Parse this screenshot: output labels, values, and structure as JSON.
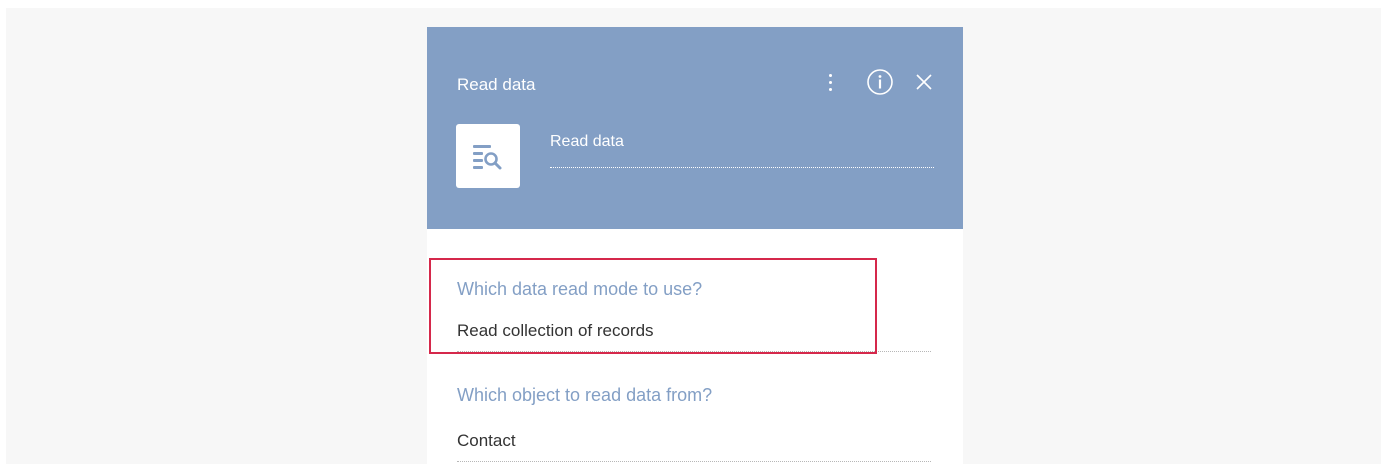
{
  "panel": {
    "title": "Read data",
    "icons": {
      "more": "more-vertical-icon",
      "info": "info-icon",
      "close": "close-icon",
      "element": "read-data-icon"
    },
    "name_value": "Read data"
  },
  "fields": [
    {
      "label": "Which data read mode to use?",
      "value": "Read collection of records"
    },
    {
      "label": "Which object to read data from?",
      "value": "Contact"
    }
  ],
  "colors": {
    "header_bg": "#839fc5",
    "label": "#839fc5",
    "highlight": "#d5284b"
  }
}
